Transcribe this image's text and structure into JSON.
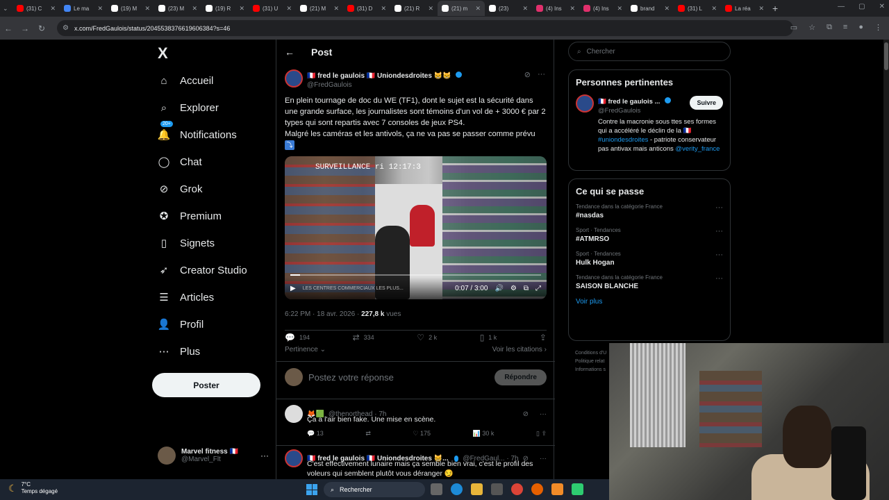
{
  "browser": {
    "tabs": [
      {
        "title": "(31) C",
        "color": "#ff0000"
      },
      {
        "title": "Le ma",
        "color": "#4285f4"
      },
      {
        "title": "(19) M",
        "color": "#ffffff"
      },
      {
        "title": "(23) M",
        "color": "#ffffff"
      },
      {
        "title": "(19) R",
        "color": "#ffffff"
      },
      {
        "title": "(31) U",
        "color": "#ff0000"
      },
      {
        "title": "(21) M",
        "color": "#ffffff"
      },
      {
        "title": "(31) D",
        "color": "#ff0000"
      },
      {
        "title": "(21) R",
        "color": "#ffffff"
      },
      {
        "title": "(21) m",
        "color": "#ffffff",
        "active": true
      },
      {
        "title": "(23)",
        "color": "#ffffff"
      },
      {
        "title": "(4) Ins",
        "color": "#e1306c"
      },
      {
        "title": "(4) Ins",
        "color": "#e1306c"
      },
      {
        "title": "brand",
        "color": "#ffffff"
      },
      {
        "title": "(31) L",
        "color": "#ff0000"
      },
      {
        "title": "La réa",
        "color": "#ff0000"
      }
    ],
    "url": "x.com/FredGaulois/status/2045538376619606384?s=46"
  },
  "nav": {
    "logo": "X",
    "items": [
      {
        "label": "Accueil",
        "icon": "home-icon",
        "glyph": "⌂"
      },
      {
        "label": "Explorer",
        "icon": "search-icon",
        "glyph": "⌕"
      },
      {
        "label": "Notifications",
        "icon": "bell-icon",
        "glyph": "🔔",
        "badge": "20+"
      },
      {
        "label": "Chat",
        "icon": "chat-icon",
        "glyph": "◯"
      },
      {
        "label": "Grok",
        "icon": "grok-icon",
        "glyph": "⊘"
      },
      {
        "label": "Premium",
        "icon": "premium-icon",
        "glyph": "✪"
      },
      {
        "label": "Signets",
        "icon": "bookmark-icon",
        "glyph": "▯"
      },
      {
        "label": "Creator Studio",
        "icon": "rocket-icon",
        "glyph": "➶"
      },
      {
        "label": "Articles",
        "icon": "article-icon",
        "glyph": "☰"
      },
      {
        "label": "Profil",
        "icon": "profile-icon",
        "glyph": "👤"
      },
      {
        "label": "Plus",
        "icon": "more-icon",
        "glyph": "⋯"
      }
    ],
    "post_button": "Poster",
    "account": {
      "name": "Marvel fitness 🇫🇷",
      "handle": "@Marvel_Flt"
    }
  },
  "main": {
    "header": "Post",
    "tweet": {
      "author": "🇫🇷 fred le gaulois 🇫🇷 Uniondesdroites 😸😸",
      "handle": "@FredGaulois",
      "text": "En plein tournage de doc du WE (TF1), dont le sujet est la sécurité dans une grande surface, les journalistes sont témoins d'un vol de + 3000 € par 2 types qui sont repartis avec 7 consoles de jeux PS4.\nMalgré les caméras et les antivols, ça ne va pas se passer comme prévu",
      "emoji": "⤵",
      "video": {
        "overlay": "SURVEILLANCE  ri 12:17:3",
        "time": "0:07 / 3:00",
        "progress": 0.04,
        "bottom_caption": "LES CENTRES COMMERCIAUX LES PLUS..."
      },
      "date": "6:22 PM · 18 avr. 2026 · ",
      "views": "227,8 k",
      "views_label": " vues",
      "stats": {
        "replies": "194",
        "reposts": "334",
        "likes": "2 k",
        "bookmarks": "1 k"
      }
    },
    "sort": "Pertinence ⌄",
    "quotes": "Voir les citations ›",
    "reply_placeholder": "Postez votre réponse",
    "reply_button": "Répondre",
    "replies": [
      {
        "author": "🦊🟩",
        "handle": "@thenorthead · 7h",
        "text": "Ça a l'air bien fake. Une mise en scène.",
        "stats": {
          "replies": "13",
          "reposts": "",
          "likes": "175",
          "views": "30 k"
        }
      },
      {
        "author": "🇫🇷 fred le gaulois 🇫🇷 Uniondesdroites 😸...",
        "handle": "@FredGaul... · 7h",
        "text": "C'est effectivement lunaire mais ça semble bien vrai, c'est le profil des voleurs qui semblent plutôt vous déranger 😏"
      }
    ]
  },
  "sidebar": {
    "search_placeholder": "Chercher",
    "relevant": {
      "title": "Personnes pertinentes",
      "name": "🇫🇷 fred le gaulois ...",
      "handle": "@FredGaulois",
      "follow": "Suivre",
      "bio_start": "Contre la macronie sous ttes ses formes qui a accéléré le déclin de la 🇫🇷 ",
      "bio_tag": "#uniondesdroites",
      "bio_mid": " - patriote conservateur pas antivax mais anticons ",
      "bio_mention": "@verity_france"
    },
    "trends": {
      "title": "Ce qui se passe",
      "items": [
        {
          "context": "Tendance dans la catégorie France",
          "name": "#nasdas"
        },
        {
          "context": "Sport · Tendances",
          "name": "#ATMRSO"
        },
        {
          "context": "Sport · Tendances",
          "name": "Hulk Hogan"
        },
        {
          "context": "Tendance dans la catégorie France",
          "name": "SAISON BLANCHE"
        }
      ],
      "see_more": "Voir plus"
    },
    "footer": [
      "Conditions d'U",
      "Politique relat",
      "Informations s"
    ]
  },
  "taskbar": {
    "temp": "7°C",
    "weather": "Temps dégagé",
    "search": "Rechercher"
  }
}
